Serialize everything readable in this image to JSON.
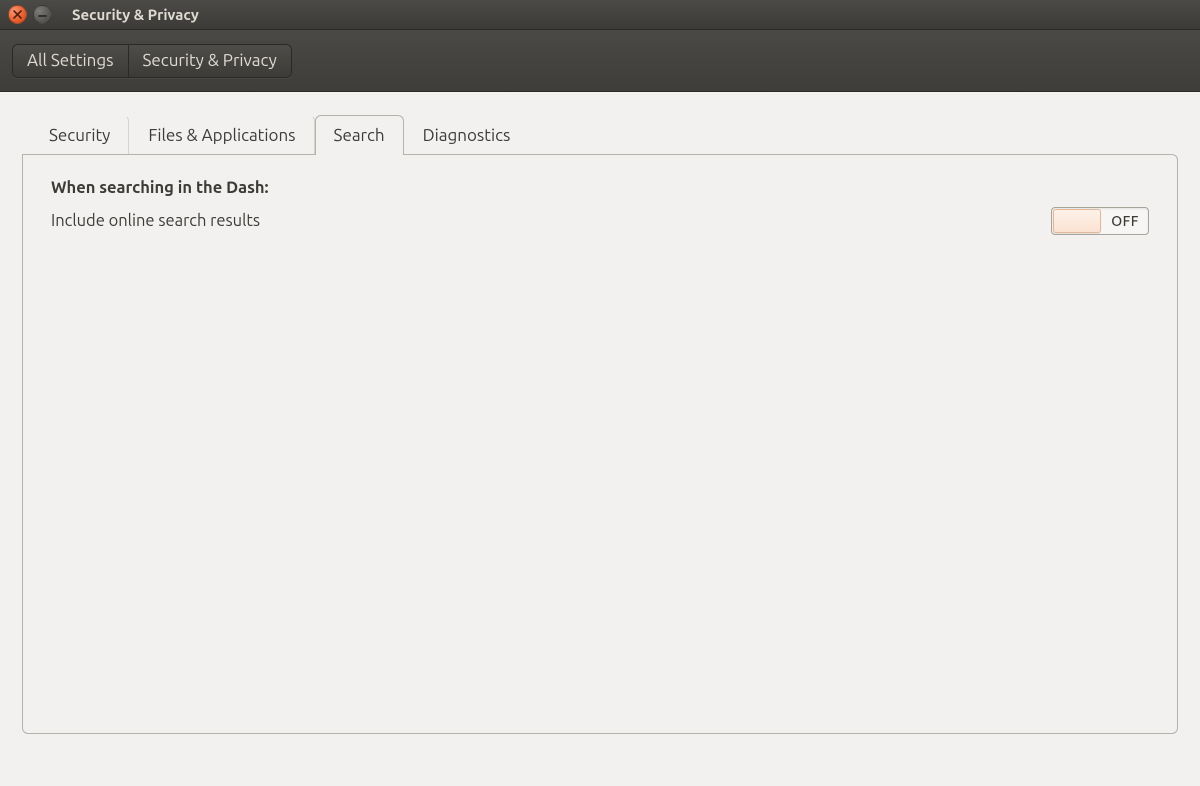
{
  "window": {
    "title": "Security & Privacy",
    "close_icon": "close-icon",
    "minimize_icon": "minimize-icon"
  },
  "breadcrumb": {
    "items": [
      {
        "label": "All Settings"
      },
      {
        "label": "Security & Privacy"
      }
    ]
  },
  "tabs": {
    "items": [
      {
        "label": "Security",
        "active": false
      },
      {
        "label": "Files & Applications",
        "active": false
      },
      {
        "label": "Search",
        "active": true
      },
      {
        "label": "Diagnostics",
        "active": false
      }
    ]
  },
  "panel": {
    "heading": "When searching in the Dash:",
    "option_label": "Include online search results",
    "toggle_state": "OFF"
  }
}
